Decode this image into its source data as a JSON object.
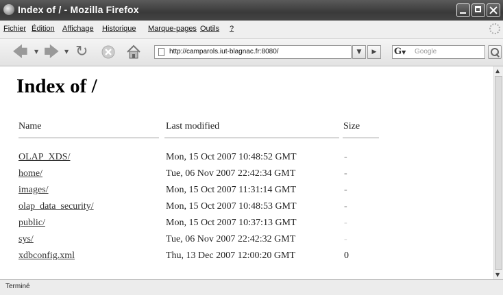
{
  "window": {
    "title": "Index of / - Mozilla Firefox"
  },
  "menu": {
    "items": [
      "Fichier",
      "Édition",
      "Affichage",
      "Historique",
      "Marque-pages",
      "Outils",
      "?"
    ]
  },
  "navigation": {
    "url": "http://camparols.iut-blagnac.fr:8080/",
    "search_placeholder": "Google",
    "search_engine_icon": "G"
  },
  "page": {
    "heading": "Index of /",
    "columns": {
      "name": "Name",
      "modified": "Last modified",
      "size": "Size"
    },
    "rows": [
      {
        "name": "OLAP_XDS/",
        "modified": "Mon, 15 Oct 2007 10:48:52 GMT",
        "size": "-"
      },
      {
        "name": "home/",
        "modified": "Tue, 06 Nov 2007 22:42:34 GMT",
        "size": "-"
      },
      {
        "name": "images/",
        "modified": "Mon, 15 Oct 2007 11:31:14 GMT",
        "size": "-"
      },
      {
        "name": "olap_data_security/",
        "modified": "Mon, 15 Oct 2007 10:48:53 GMT",
        "size": "-"
      },
      {
        "name": "public/",
        "modified": "Mon, 15 Oct 2007 10:37:13 GMT",
        "size": "-"
      },
      {
        "name": "sys/",
        "modified": "Tue, 06 Nov 2007 22:42:32 GMT",
        "size": "-"
      },
      {
        "name": "xdbconfig.xml",
        "modified": "Thu, 13 Dec 2007 12:00:20 GMT",
        "size": "0"
      }
    ]
  },
  "status": {
    "text": "Terminé"
  }
}
